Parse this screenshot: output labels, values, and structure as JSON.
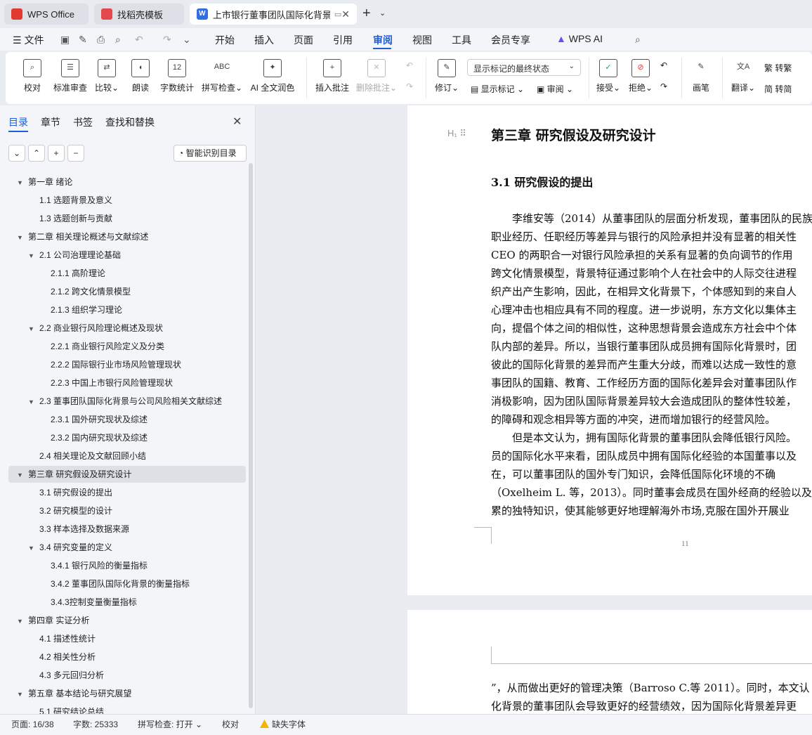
{
  "tabs": {
    "wps": "WPS Office",
    "template": "找稻壳模板",
    "doc": "上市银行董事团队国际化背景"
  },
  "menu": {
    "file": "文件",
    "items": [
      "开始",
      "插入",
      "页面",
      "引用",
      "审阅",
      "视图",
      "工具",
      "会员专享",
      "WPS AI"
    ],
    "active": "审阅"
  },
  "ribbon": {
    "proofread": "校对",
    "std_review": "标准审查",
    "compare": "比较",
    "read_aloud": "朗读",
    "word_count": "字数统计",
    "spell_check": "拼写检查",
    "ai_proof": "AI 全文润色",
    "insert_comment": "插入批注",
    "delete_comment": "删除批注",
    "track": "修订",
    "markup_select": "显示标记的最终状态",
    "show_markup": "显示标记",
    "review_pane": "审阅",
    "accept": "接受",
    "reject": "拒绝",
    "ink": "画笔",
    "translate": "翻译",
    "to_trad": "转繁",
    "to_simp": "转简"
  },
  "sidebar": {
    "tabs": [
      "目录",
      "章节",
      "书签",
      "查找和替换"
    ],
    "smart_btn": "智能识别目录",
    "toc": [
      {
        "label": "第一章  绪论",
        "level": 1,
        "tri": true
      },
      {
        "label": "1.1  选题背景及意义",
        "level": 2,
        "tri": false
      },
      {
        "label": "1.3  选题创新与贡献",
        "level": 2,
        "tri": false
      },
      {
        "label": "第二章  相关理论概述与文献综述",
        "level": 1,
        "tri": true
      },
      {
        "label": "2.1  公司治理理论基础",
        "level": 2,
        "tri": true
      },
      {
        "label": "2.1.1  高阶理论",
        "level": 3,
        "tri": false
      },
      {
        "label": "2.1.2  跨文化情景模型",
        "level": 3,
        "tri": false
      },
      {
        "label": "2.1.3 组织学习理论",
        "level": 3,
        "tri": false
      },
      {
        "label": "2.2 商业银行风险理论概述及现状",
        "level": 2,
        "tri": true
      },
      {
        "label": "2.2.1  商业银行风险定义及分类",
        "level": 3,
        "tri": false
      },
      {
        "label": "2.2.2  国际银行业市场风险管理现状",
        "level": 3,
        "tri": false
      },
      {
        "label": "2.2.3  中国上市银行风险管理现状",
        "level": 3,
        "tri": false
      },
      {
        "label": "2.3  董事团队国际化背景与公司风险相关文献综述",
        "level": 2,
        "tri": true
      },
      {
        "label": "2.3.1  国外研究现状及综述",
        "level": 3,
        "tri": false
      },
      {
        "label": "2.3.2  国内研究现状及综述",
        "level": 3,
        "tri": false
      },
      {
        "label": "2.4 相关理论及文献回顾小结",
        "level": 2,
        "tri": false
      },
      {
        "label": "第三章  研究假设及研究设计",
        "level": 1,
        "tri": true
      },
      {
        "label": "3.1  研究假设的提出",
        "level": 2,
        "tri": false
      },
      {
        "label": "3.2  研究模型的设计",
        "level": 2,
        "tri": false
      },
      {
        "label": "3.3  样本选择及数据来源",
        "level": 2,
        "tri": false
      },
      {
        "label": "3.4  研究变量的定义",
        "level": 2,
        "tri": true
      },
      {
        "label": "3.4.1  银行风险的衡量指标",
        "level": 3,
        "tri": false
      },
      {
        "label": "3.4.2  董事团队国际化背景的衡量指标",
        "level": 3,
        "tri": false
      },
      {
        "label": "3.4.3控制变量衡量指标",
        "level": 3,
        "tri": false
      },
      {
        "label": "第四章  实证分析",
        "level": 1,
        "tri": true
      },
      {
        "label": "4.1  描述性统计",
        "level": 2,
        "tri": false
      },
      {
        "label": "4.2  相关性分析",
        "level": 2,
        "tri": false
      },
      {
        "label": "4.3  多元回归分析",
        "level": 2,
        "tri": false
      },
      {
        "label": "第五章  基本结论与研究展望",
        "level": 1,
        "tri": true
      },
      {
        "label": "5.1 研究结论总结",
        "level": 2,
        "tri": false
      }
    ]
  },
  "document": {
    "chapter": "第三章  研究假设及研究设计",
    "section": "3.1  研究假设的提出",
    "lines": [
      "李维安等（2014）从董事团队的层面分析发现，董事团队的民族",
      "职业经历、任职经历等差异与银行的风险承担并没有显著的相关性",
      "CEO 的两职合一对银行风险承担的关系有显著的负向调节的作用",
      "跨文化情景模型，背景特征通过影响个人在社会中的人际交往进程",
      "织产出产生影响，因此，在相异文化背景下，个体感知到的来自人",
      "心理冲击也相应具有不同的程度。进一步说明，东方文化以集体主",
      "向，提倡个体之间的相似性，这种思想背景会造成东方社会中个体",
      "队内部的差异。所以，当银行董事团队成员拥有国际化背景时，团",
      "彼此的国际化背景的差异而产生重大分歧，而难以达成一致性的意",
      "事团队的国籍、教育、工作经历方面的国际化差异会对董事团队作",
      "消极影响，因为团队国际背景差异较大会造成团队的整体性较差，",
      "的障碍和观念相异等方面的冲突，进而增加银行的经营风险。",
      "但是本文认为，拥有国际化背景的董事团队会降低银行风险。",
      "员的国际化水平来看，团队成员中拥有国际化经验的本国董事以及",
      "在，可以董事团队的国外专门知识，会降低国际化环境的不确",
      "（Oxelheim L. 等，2013）。同时董事会成员在国外经商的经验以及",
      "累的独特知识，使其能够更好地理解海外市场,克服在国外开展业"
    ],
    "page_number": "11",
    "page2_lines": [
      "”，从而做出更好的管理决策（Barroso C.等 2011）。同时，本文认",
      "化背景的董事团队会导致更好的经营绩效，因为国际化背景差异更"
    ]
  },
  "status": {
    "page": "页面: 16/38",
    "words": "字数: 25333",
    "spell": "拼写检查: 打开",
    "proof": "校对",
    "missing_font": "缺失字体"
  }
}
